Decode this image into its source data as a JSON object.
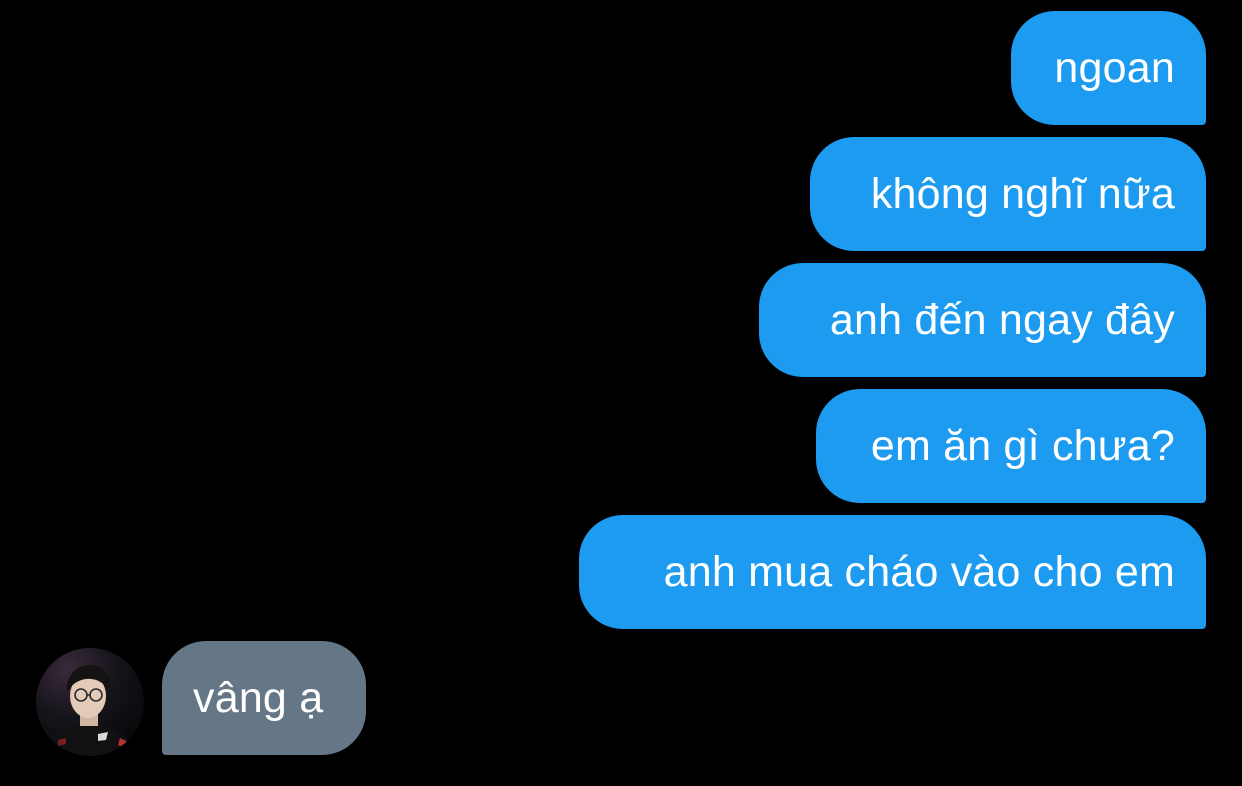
{
  "conversation": {
    "sent_messages": [
      {
        "text": "ngoan"
      },
      {
        "text": "không nghĩ nữa"
      },
      {
        "text": "anh đến ngay đây"
      },
      {
        "text": "em ăn gì chưa?"
      },
      {
        "text": "anh mua cháo vào cho em"
      }
    ],
    "received_messages": [
      {
        "text": "vâng ạ"
      }
    ]
  },
  "colors": {
    "background": "#000000",
    "sent_bubble": "#1d9bf0",
    "received_bubble": "#657786",
    "bubble_text": "#ffffff"
  },
  "icons": {
    "avatar": "profile-photo"
  }
}
